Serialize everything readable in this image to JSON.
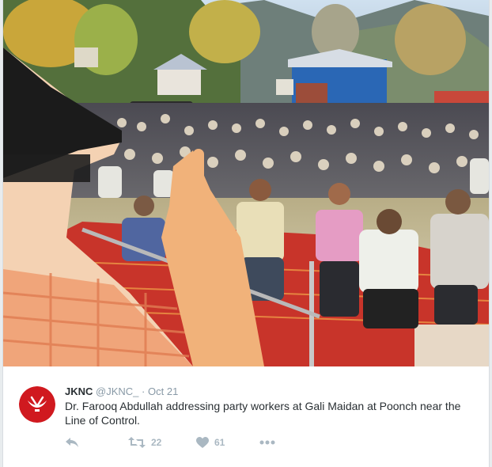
{
  "tweet": {
    "display_name": "JKNC",
    "handle": "@JKNC_",
    "separator": "·",
    "date": "Oct 21",
    "text": "Dr. Farooq Abdullah addressing party workers at Gali Maidan at Poonch near the Line of Control.",
    "avatar_icon": "jknc-plough-logo-icon",
    "avatar_color": "#d0191f"
  },
  "media": {
    "description_icon": "rally-photo"
  },
  "actions": {
    "reply_icon": "reply-icon",
    "retweet_icon": "retweet-icon",
    "retweet_count": "22",
    "like_icon": "heart-icon",
    "like_count": "61",
    "more_icon": "more-dots-icon"
  },
  "colors": {
    "text": "#292f33",
    "muted": "#8899a6",
    "action": "#aab8c2"
  }
}
